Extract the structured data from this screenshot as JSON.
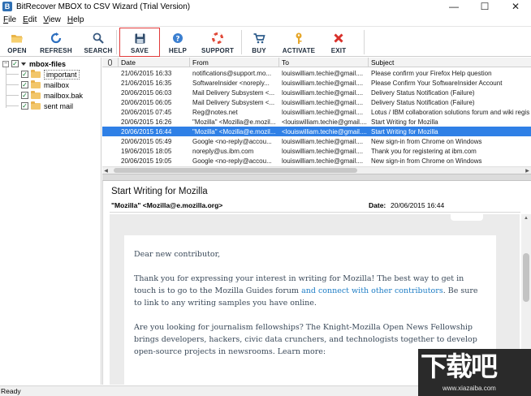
{
  "window": {
    "title": "BitRecover MBOX to CSV Wizard (Trial Version)",
    "icon_letter": "B",
    "controls": [
      "—",
      "☐",
      "✕"
    ]
  },
  "menu": {
    "items": [
      {
        "first": "F",
        "rest": "ile"
      },
      {
        "first": "E",
        "rest": "dit"
      },
      {
        "first": "V",
        "rest": "iew"
      },
      {
        "first": "H",
        "rest": "elp"
      }
    ]
  },
  "toolbar": {
    "open": "OPEN",
    "refresh": "REFRESH",
    "search": "SEARCH",
    "save": "SAVE",
    "help": "HELP",
    "support": "SUPPORT",
    "buy": "BUY",
    "activate": "ACTIVATE",
    "exit": "EXIT",
    "icons": {
      "open": "folder-open-icon",
      "refresh": "refresh-icon",
      "search": "magnifier-icon",
      "save": "floppy-disk-icon",
      "help": "help-icon",
      "support": "lifebuoy-icon",
      "buy": "cart-icon",
      "activate": "key-icon",
      "exit": "close-x-icon"
    }
  },
  "tree": {
    "root": "mbox-files",
    "items": [
      "important",
      "mailbox",
      "mailbox.bak",
      "sent mail"
    ],
    "collapse_glyph": "−",
    "check_glyph": "✓"
  },
  "list": {
    "headers": {
      "date": "Date",
      "from": "From",
      "to": "To",
      "subject": "Subject"
    },
    "rows": [
      {
        "date": "21/06/2015 16:33",
        "from": "notifications@support.mo...",
        "to": "louiswilliam.techie@gmail....",
        "subject": "Please confirm your Firefox Help question"
      },
      {
        "date": "21/06/2015 16:35",
        "from": "SoftwareInsider <noreply...",
        "to": "louiswilliam.techie@gmail....",
        "subject": "Please Confirm Your SoftwareInsider Account"
      },
      {
        "date": "20/06/2015 06:03",
        "from": "Mail Delivery Subsystem <...",
        "to": "louiswilliam.techie@gmail....",
        "subject": "Delivery Status Notification (Failure)"
      },
      {
        "date": "20/06/2015 06:05",
        "from": "Mail Delivery Subsystem <...",
        "to": "louiswilliam.techie@gmail....",
        "subject": "Delivery Status Notification (Failure)"
      },
      {
        "date": "20/06/2015 07:45",
        "from": "Reg@notes.net",
        "to": "louiswilliam.techie@gmail....",
        "subject": "Lotus / IBM collaboration solutions forum and wiki regis"
      },
      {
        "date": "20/06/2015 16:26",
        "from": "\"Mozilla\" <Mozilla@e.mozil...",
        "to": "<louiswilliam.techie@gmail....",
        "subject": "Start Writing for Mozilla"
      },
      {
        "date": "20/06/2015 16:44",
        "from": "\"Mozilla\" <Mozilla@e.mozil...",
        "to": "<louiswilliam.techie@gmail....",
        "subject": "Start Writing for Mozilla"
      },
      {
        "date": "20/06/2015 05:49",
        "from": "Google <no-reply@accou...",
        "to": "louiswilliam.techie@gmail....",
        "subject": "New sign-in from Chrome on Windows"
      },
      {
        "date": "19/06/2015 18:05",
        "from": "noreply@us.ibm.com",
        "to": "louiswilliam.techie@gmail....",
        "subject": "Thank you for registering at ibm.com"
      },
      {
        "date": "20/06/2015 19:05",
        "from": "Google <no-reply@accou...",
        "to": "louiswilliam.techie@gmail....",
        "subject": "New sign-in from Chrome on Windows"
      }
    ],
    "selected_index": 6,
    "selected_color": "#2f80e6"
  },
  "preview": {
    "subject": "Start Writing for Mozilla",
    "from": "\"Mozilla\" <Mozilla@e.mozilla.org>",
    "date_label": "Date:",
    "date": "20/06/2015 16:44",
    "greeting": "Dear new contributor,",
    "p1_a": "Thank you for expressing your interest in writing for Mozilla! The best way to get in touch is to go to the Mozilla Guides forum ",
    "p1_link": "and connect with other contributors",
    "p1_b": ". Be sure to link to any writing samples you have online.",
    "p2": "Are you looking for journalism fellowships? The Knight-Mozilla Open News Fellowship brings developers, hackers, civic data crunchers, and technologists together to develop open-source projects in newsrooms. Learn more: "
  },
  "status": {
    "text": "Ready"
  },
  "watermark": {
    "main": "下载吧",
    "url": "www.xiazaiba.com"
  }
}
